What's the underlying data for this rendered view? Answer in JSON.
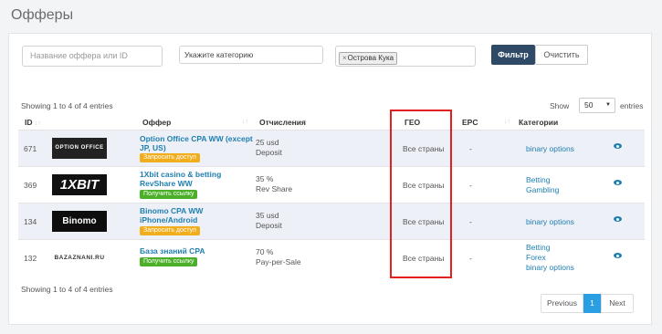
{
  "page": {
    "title": "Офферы"
  },
  "filters": {
    "offer_placeholder": "Название оффера или ID",
    "category_placeholder": "Укажите категорию",
    "geo_tag": "Острова Кука",
    "geo_tag_remove": "×",
    "filter_button": "Фильтр",
    "clear_button": "Очистить"
  },
  "table": {
    "info_top": "Showing 1 to 4 of 4 entries",
    "info_bottom": "Showing 1 to 4 of 4 entries",
    "show_label": "Show",
    "show_value": "50",
    "entries_label": "entries",
    "headers": {
      "id": "ID",
      "offer": "Оффер",
      "deductions": "Отчисления",
      "geo": "ГЕО",
      "epc": "EPC",
      "categories": "Категории"
    },
    "rows": [
      {
        "id": "671",
        "logo": "OPTION OFFICE",
        "name": "Option Office CPA WW (except JP, US)",
        "action": "Запросить доступ",
        "action_color": "#f0ad1c",
        "amount": "25 usd",
        "type": "Deposit",
        "geo": "Все страны",
        "epc": "-",
        "categories": [
          "binary options"
        ]
      },
      {
        "id": "369",
        "logo": "1XBIT",
        "name": "1Xbit casino & betting RevShare WW",
        "action": "Получить ссылку",
        "action_color": "#4caf2a",
        "amount": "35 %",
        "type": "Rev Share",
        "geo": "Все страны",
        "epc": "-",
        "categories": [
          "Betting",
          "Gambling"
        ]
      },
      {
        "id": "134",
        "logo": "Binomo",
        "name": "Binomo CPA WW iPhone/Android",
        "action": "Запросить доступ",
        "action_color": "#f0ad1c",
        "amount": "35 usd",
        "type": "Deposit",
        "geo": "Все страны",
        "epc": "-",
        "categories": [
          "binary options"
        ]
      },
      {
        "id": "132",
        "logo": "BAZAZNANI.RU",
        "name": "База знаний CPA",
        "action": "Получить ссылку",
        "action_color": "#4caf2a",
        "amount": "70 %",
        "type": "Pay-per-Sale",
        "geo": "Все страны",
        "epc": "-",
        "categories": [
          "Betting",
          "Forex",
          "binary options"
        ]
      }
    ]
  },
  "pagination": {
    "previous": "Previous",
    "page": "1",
    "next": "Next"
  },
  "colors": {
    "accent": "#2f4a67",
    "link": "#1f7fb0",
    "highlight": "#e32020",
    "active_page": "#2a9ee2"
  }
}
